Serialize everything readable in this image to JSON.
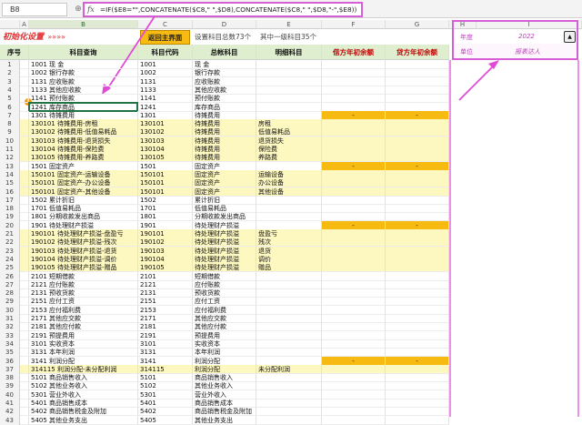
{
  "formula_bar": {
    "name_box": "B8",
    "fx": "fx",
    "formula": "=IF($E8=\"\",CONCATENATE($C8,\" \",$D8),CONCATENATE($C8,\" \",$D8,\"-\",$E8))"
  },
  "columns": [
    "A",
    "B",
    "C",
    "D",
    "E",
    "F",
    "G",
    "H",
    "I"
  ],
  "toolbar": {
    "init_label": "初始化设置",
    "arrows": "»»»»",
    "return_button": "返回主界面",
    "total_count": "设置科目总数73个",
    "first_count": "其中一级科目35个"
  },
  "panel": {
    "year_label": "年度",
    "year_value": "2022",
    "unit_label": "单位",
    "unit_value": "报表达人"
  },
  "header": [
    "序号",
    "科目查询",
    "科目代码",
    "总帐科目",
    "明细科目",
    "借方年初余额",
    "贷方年初余额"
  ],
  "dash": "-",
  "rows": [
    {
      "n": "1",
      "q": "1001 现  金",
      "code": "1001",
      "gen": "现  金",
      "det": "",
      "y": false
    },
    {
      "n": "2",
      "q": "1002 银行存款",
      "code": "1002",
      "gen": "银行存款",
      "det": "",
      "y": false
    },
    {
      "n": "3",
      "q": "1131 应收账款",
      "code": "1131",
      "gen": "应收账款",
      "det": "",
      "y": false
    },
    {
      "n": "4",
      "q": "1133 其他应收款",
      "code": "1133",
      "gen": "其他应收款",
      "det": "",
      "y": false
    },
    {
      "n": "5",
      "q": "1141 预付账款",
      "code": "1141",
      "gen": "预付账款",
      "det": "",
      "y": false
    },
    {
      "n": "6",
      "q": "1241 库存商品",
      "code": "1241",
      "gen": "库存商品",
      "det": "",
      "y": false
    },
    {
      "n": "7",
      "q": "1301 待摊费用",
      "code": "1301",
      "gen": "待摊费用",
      "det": "",
      "y": false,
      "o": true
    },
    {
      "n": "8",
      "q": "130101 待摊费用-房租",
      "code": "130101",
      "gen": "待摊费用",
      "det": "房租",
      "y": true
    },
    {
      "n": "9",
      "q": "130102 待摊费用-低值易耗品",
      "code": "130102",
      "gen": "待摊费用",
      "det": "低值易耗品",
      "y": true
    },
    {
      "n": "10",
      "q": "130103 待摊费用-退货损失",
      "code": "130103",
      "gen": "待摊费用",
      "det": "退货损失",
      "y": true
    },
    {
      "n": "11",
      "q": "130104 待摊费用-保险费",
      "code": "130104",
      "gen": "待摊费用",
      "det": "保险费",
      "y": true
    },
    {
      "n": "12",
      "q": "130105 待摊费用-养路费",
      "code": "130105",
      "gen": "待摊费用",
      "det": "养路费",
      "y": true
    },
    {
      "n": "13",
      "q": "1501 固定资产",
      "code": "1501",
      "gen": "固定资产",
      "det": "",
      "y": false,
      "o": true
    },
    {
      "n": "14",
      "q": "150101 固定资产-运输设备",
      "code": "150101",
      "gen": "固定资产",
      "det": "运输设备",
      "y": true
    },
    {
      "n": "15",
      "q": "150101 固定资产-办公设备",
      "code": "150101",
      "gen": "固定资产",
      "det": "办公设备",
      "y": true
    },
    {
      "n": "16",
      "q": "150101 固定资产-其他设备",
      "code": "150101",
      "gen": "固定资产",
      "det": "其他设备",
      "y": true
    },
    {
      "n": "17",
      "q": "1502 累计折旧",
      "code": "1502",
      "gen": "累计折旧",
      "det": "",
      "y": false
    },
    {
      "n": "18",
      "q": "1701 低值易耗品",
      "code": "1701",
      "gen": "低值易耗品",
      "det": "",
      "y": false
    },
    {
      "n": "19",
      "q": "1801 分期收款发出商品",
      "code": "1801",
      "gen": "分期收款发出商品",
      "det": "",
      "y": false
    },
    {
      "n": "20",
      "q": "1901 待处理财产损溢",
      "code": "1901",
      "gen": "待处理财产损溢",
      "det": "",
      "y": false,
      "o": true
    },
    {
      "n": "21",
      "q": "190101 待处理财产损溢-盘盈亏",
      "code": "190101",
      "gen": "待处理财产损溢",
      "det": "盘盈亏",
      "y": true
    },
    {
      "n": "22",
      "q": "190102 待处理财产损溢-残次",
      "code": "190102",
      "gen": "待处理财产损溢",
      "det": "残次",
      "y": true
    },
    {
      "n": "23",
      "q": "190103 待处理财产损溢-退货",
      "code": "190103",
      "gen": "待处理财产损溢",
      "det": "退货",
      "y": true
    },
    {
      "n": "24",
      "q": "190104 待处理财产损溢-调价",
      "code": "190104",
      "gen": "待处理财产损溢",
      "det": "调价",
      "y": true
    },
    {
      "n": "25",
      "q": "190105 待处理财产损溢-赠品",
      "code": "190105",
      "gen": "待处理财产损溢",
      "det": "赠品",
      "y": true
    },
    {
      "n": "26",
      "q": "2101 短期借款",
      "code": "2101",
      "gen": "短期借款",
      "det": "",
      "y": false
    },
    {
      "n": "27",
      "q": "2121 应付账款",
      "code": "2121",
      "gen": "应付账款",
      "det": "",
      "y": false
    },
    {
      "n": "28",
      "q": "2131 预收货款",
      "code": "2131",
      "gen": "预收货款",
      "det": "",
      "y": false
    },
    {
      "n": "29",
      "q": "2151 应付工资",
      "code": "2151",
      "gen": "应付工资",
      "det": "",
      "y": false
    },
    {
      "n": "30",
      "q": "2153 应付福利费",
      "code": "2153",
      "gen": "应付福利费",
      "det": "",
      "y": false
    },
    {
      "n": "31",
      "q": "2171 其他应交款",
      "code": "2171",
      "gen": "其他应交款",
      "det": "",
      "y": false
    },
    {
      "n": "32",
      "q": "2181 其他应付款",
      "code": "2181",
      "gen": "其他应付款",
      "det": "",
      "y": false
    },
    {
      "n": "33",
      "q": "2191 预提费用",
      "code": "2191",
      "gen": "预提费用",
      "det": "",
      "y": false
    },
    {
      "n": "34",
      "q": "3101 实收资本",
      "code": "3101",
      "gen": "实收资本",
      "det": "",
      "y": false
    },
    {
      "n": "35",
      "q": "3131 本年利润",
      "code": "3131",
      "gen": "本年利润",
      "det": "",
      "y": false
    },
    {
      "n": "36",
      "q": "3141 利润分配",
      "code": "3141",
      "gen": "利润分配",
      "det": "",
      "y": false,
      "o": true
    },
    {
      "n": "37",
      "q": "314115 利润分配-未分配利润",
      "code": "314115",
      "gen": "利润分配",
      "det": "未分配利润",
      "y": true
    },
    {
      "n": "38",
      "q": "5101 商品销售收入",
      "code": "5101",
      "gen": "商品销售收入",
      "det": "",
      "y": false
    },
    {
      "n": "39",
      "q": "5102 其他业务收入",
      "code": "5102",
      "gen": "其他业务收入",
      "det": "",
      "y": false
    },
    {
      "n": "40",
      "q": "5301 营业外收入",
      "code": "5301",
      "gen": "营业外收入",
      "det": "",
      "y": false
    },
    {
      "n": "41",
      "q": "5401 商品销售成本",
      "code": "5401",
      "gen": "商品销售成本",
      "det": "",
      "y": false
    },
    {
      "n": "42",
      "q": "5402 商品销售税金及附加",
      "code": "5402",
      "gen": "商品销售税金及附加",
      "det": "",
      "y": false
    },
    {
      "n": "43",
      "q": "5405 其他业务支出",
      "code": "5405",
      "gen": "其他业务支出",
      "det": "",
      "y": false
    }
  ]
}
